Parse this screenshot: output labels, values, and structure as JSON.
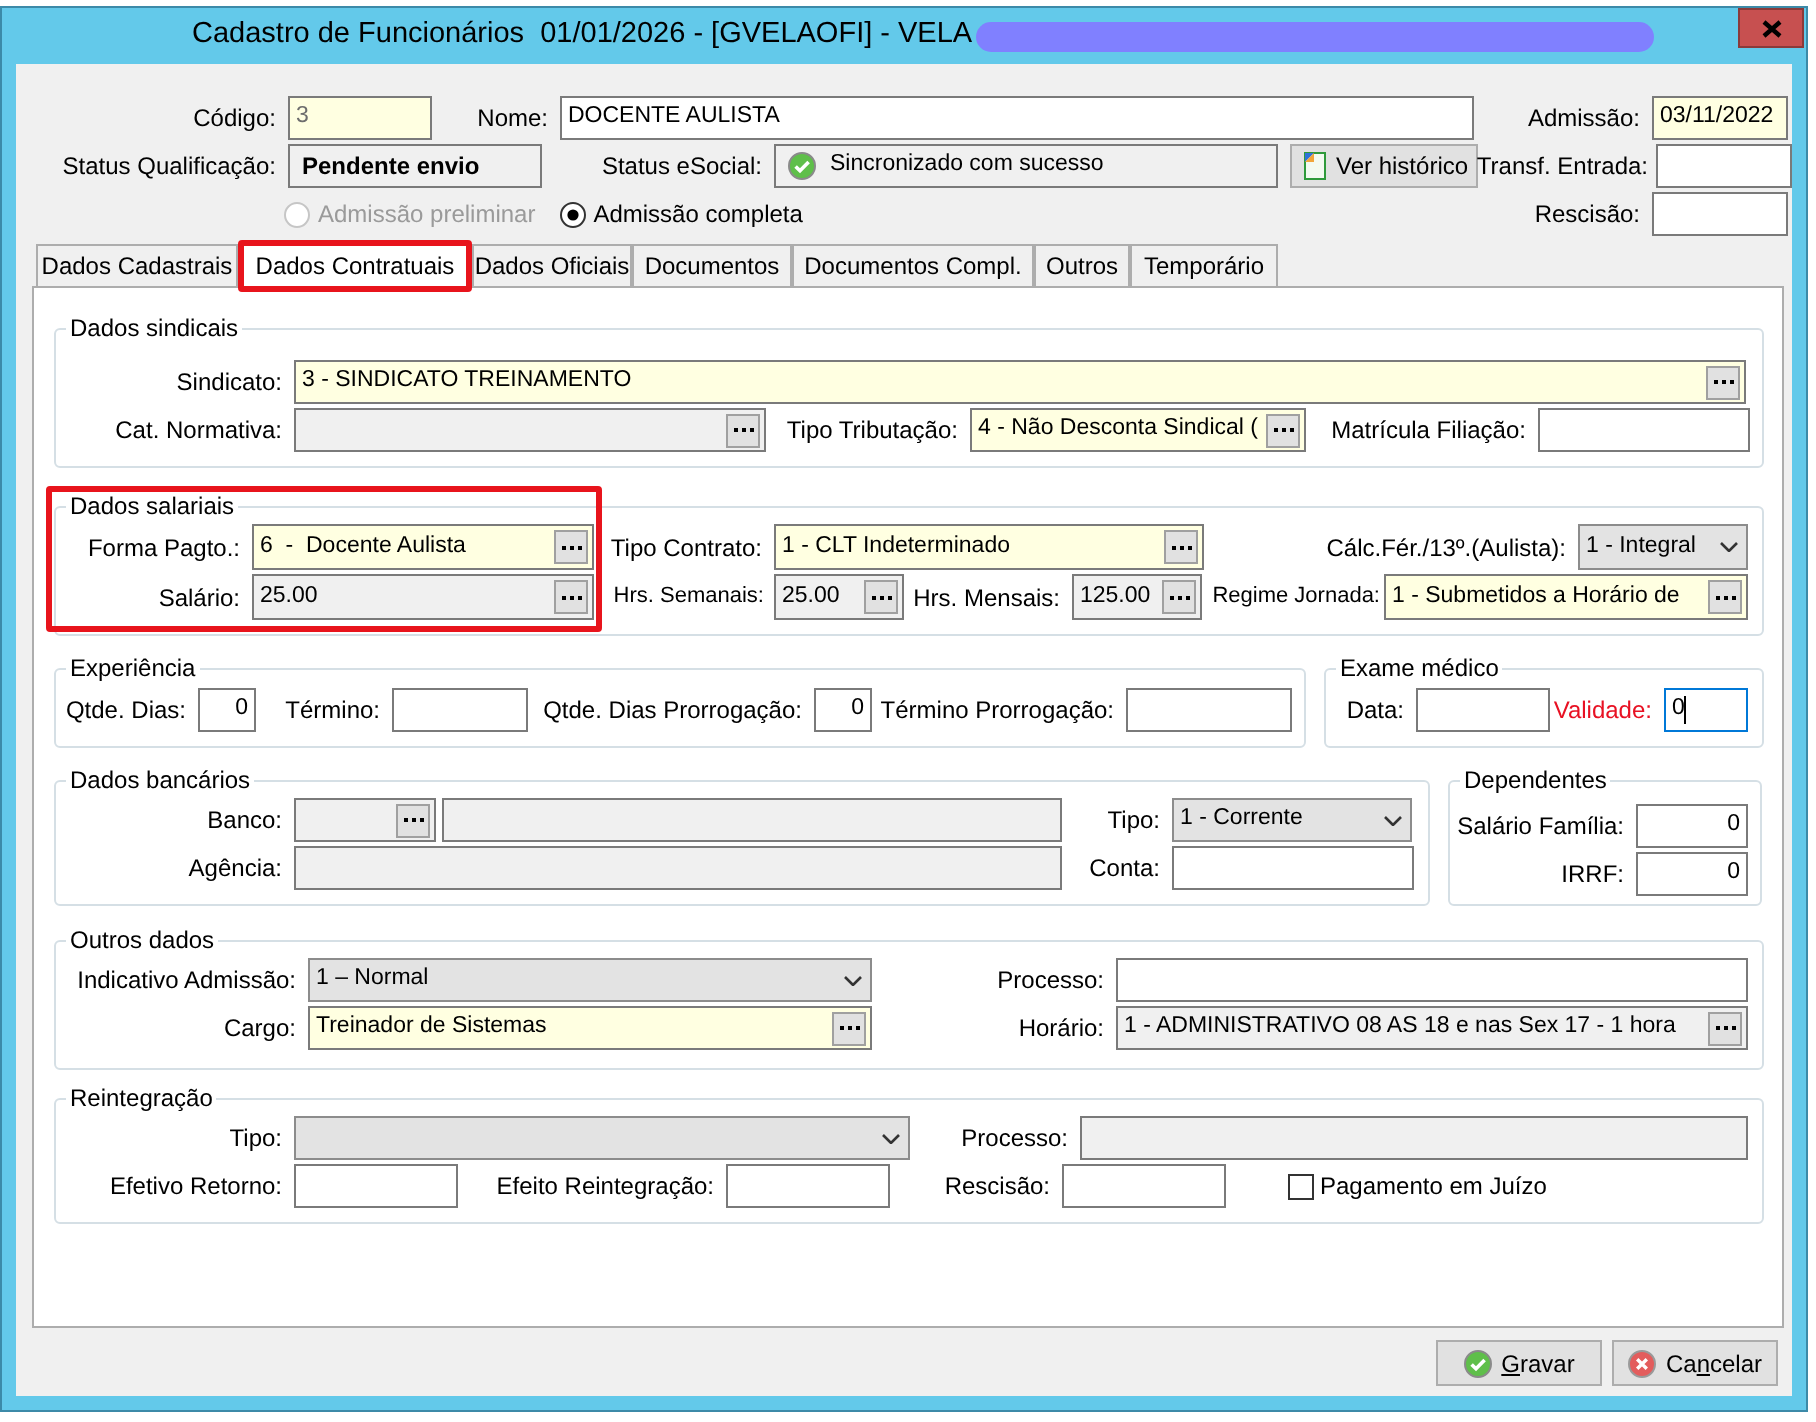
{
  "window": {
    "title": "Cadastro de Funcionários  01/01/2026 - [GVELAOFI] - VELA"
  },
  "header": [
    [
      {
        "kind": "input",
        "label": "Código:",
        "value": "3",
        "required": true,
        "readonly": true
      },
      {
        "kind": "input",
        "label": "Nome:",
        "value": "DOCENTE AULISTA",
        "required": false,
        "readonly": false
      },
      {
        "kind": "input",
        "label": "Admissão:",
        "value": "03/11/2022",
        "required": true,
        "readonly": false
      }
    ],
    [
      {
        "kind": "status",
        "label": "Status Qualificação:",
        "value": "Pendente envio",
        "synced": false
      },
      {
        "kind": "status",
        "label": "Status eSocial:",
        "value": "Sincronizado com sucesso",
        "synced": true
      },
      {
        "kind": "button",
        "label": "Ver histórico"
      },
      {
        "kind": "input",
        "label": "Transf. Entrada:",
        "required": false,
        "readonly": false
      }
    ],
    [
      {
        "kind": "radio",
        "label": "Admissão preliminar",
        "selected": false,
        "disabled": true
      },
      {
        "kind": "radio",
        "label": "Admissão completa",
        "selected": true,
        "disabled": false
      },
      {
        "kind": "input",
        "label": "Rescisão:",
        "required": false,
        "readonly": false
      }
    ]
  ],
  "tabs": [
    {
      "label": "Dados Cadastrais",
      "selected": false,
      "highlighted": false
    },
    {
      "label": "Dados Contratuais",
      "selected": true,
      "highlighted": true
    },
    {
      "label": "Dados Oficiais",
      "selected": false,
      "highlighted": false
    },
    {
      "label": "Documentos",
      "selected": false,
      "highlighted": false
    },
    {
      "label": "Documentos Compl.",
      "selected": false,
      "highlighted": false
    },
    {
      "label": "Outros",
      "selected": false,
      "highlighted": false
    },
    {
      "label": "Temporário",
      "selected": false,
      "highlighted": false
    }
  ],
  "groups": [
    {
      "title": "Dados sindicais",
      "highlighted": false,
      "rows": [
        [
          {
            "kind": "lookup",
            "label": "Sindicato:",
            "value": "3 - SINDICATO TREINAMENTO",
            "required": true,
            "readonly": false
          }
        ],
        [
          {
            "kind": "lookup",
            "label": "Cat. Normativa:",
            "required": false,
            "readonly": true
          },
          {
            "kind": "lookup",
            "label": "Tipo Tributação:",
            "value": "4 - Não Desconta Sindical (",
            "required": true,
            "readonly": false
          },
          {
            "kind": "input",
            "label": "Matrícula Filiação:",
            "required": false,
            "readonly": false
          }
        ]
      ]
    },
    {
      "title": "Dados salariais",
      "highlighted": true,
      "rows": [
        [
          {
            "kind": "lookup",
            "label": "Forma Pagto.:",
            "value": "6  -  Docente Aulista",
            "required": true,
            "readonly": false
          },
          {
            "kind": "lookup",
            "label": "Tipo Contrato:",
            "value": "1 - CLT Indeterminado",
            "required": true,
            "readonly": false
          },
          "",
          {
            "kind": "select",
            "label": "Cálc.Fér./13º.(Aulista):",
            "value": "1 - Integral"
          }
        ],
        [
          {
            "kind": "lookup",
            "label": "Salário:",
            "value": "25.00",
            "required": false,
            "readonly": true
          },
          {
            "kind": "lookup",
            "label": "Hrs. Semanais:",
            "value": "25.00",
            "required": false,
            "readonly": true
          },
          {
            "kind": "lookup",
            "label": "Hrs. Mensais:",
            "value": "125.00",
            "required": false,
            "readonly": true
          },
          {
            "kind": "lookup",
            "label": "Regime Jornada:",
            "value": "1 - Submetidos a Horário de",
            "required": true,
            "readonly": false
          }
        ]
      ]
    },
    {
      "title": "Experiência",
      "highlighted": false,
      "rows": [
        [
          {
            "kind": "input",
            "label": "Qtde. Dias:",
            "value": "0",
            "required": false,
            "readonly": false
          },
          {
            "kind": "input",
            "label": "Término:",
            "required": false,
            "readonly": false
          },
          {
            "kind": "input",
            "label": "Qtde. Dias Prorrogação:",
            "value": "0",
            "required": false,
            "readonly": false
          },
          {
            "kind": "input",
            "label": "Término Prorrogação:",
            "required": false,
            "readonly": false
          }
        ]
      ]
    },
    {
      "title": "Exame médico",
      "highlighted": false,
      "rows": [
        [
          {
            "kind": "input",
            "label": "Data:",
            "required": false,
            "readonly": false,
            "focused": false,
            "label_alert": false
          },
          {
            "kind": "input",
            "label": "Validade:",
            "value": "0",
            "required": false,
            "readonly": false,
            "focused": true,
            "label_alert": true
          }
        ]
      ]
    },
    {
      "title": "Dados bancários",
      "highlighted": false,
      "rows": [
        [
          {
            "kind": "lookup",
            "label": "Banco:",
            "required": false,
            "readonly": true
          },
          {
            "kind": "input",
            "required": false,
            "readonly": true
          },
          {
            "kind": "select",
            "label": "Tipo:",
            "value": "1 - Corrente"
          }
        ],
        [
          {
            "kind": "input",
            "label": "Agência:",
            "required": false,
            "readonly": true
          },
          {
            "kind": "input",
            "label": "Conta:",
            "required": false,
            "readonly": false
          }
        ]
      ]
    },
    {
      "title": "Dependentes",
      "highlighted": false,
      "rows": [
        [
          {
            "kind": "input",
            "label": "Salário Família:",
            "value": "0",
            "required": false,
            "readonly": false
          }
        ],
        [
          {
            "kind": "input",
            "label": "IRRF:",
            "value": "0",
            "required": false,
            "readonly": false
          }
        ]
      ]
    },
    {
      "title": "Outros dados",
      "highlighted": false,
      "rows": [
        [
          {
            "kind": "select",
            "label": "Indicativo Admissão:",
            "value": "1 – Normal"
          },
          {
            "kind": "input",
            "label": "Processo:",
            "required": false,
            "readonly": false
          }
        ],
        [
          {
            "kind": "lookup",
            "label": "Cargo:",
            "value": "Treinador de Sistemas",
            "required": true,
            "readonly": false
          },
          {
            "kind": "lookup",
            "label": "Horário:",
            "value": "1 - ADMINISTRATIVO 08 AS 18 e nas Sex 17 - 1 hora",
            "required": false,
            "readonly": true
          }
        ]
      ]
    },
    {
      "title": "Reintegração",
      "highlighted": false,
      "rows": [
        [
          {
            "kind": "select",
            "label": "Tipo:"
          },
          "",
          {
            "kind": "input",
            "label": "Processo:",
            "required": false,
            "readonly": true
          }
        ],
        [
          {
            "kind": "input",
            "label": "Efetivo Retorno:",
            "required": false,
            "readonly": false
          },
          {
            "kind": "input",
            "label": "Efeito Reintegração:",
            "required": false,
            "readonly": false
          },
          {
            "kind": "input",
            "label": "Rescisão:",
            "required": false,
            "readonly": false
          },
          {
            "kind": "checkbox",
            "label": "Pagamento em Juízo",
            "checked": false
          }
        ]
      ]
    }
  ],
  "buttons": [
    {
      "kind": "save",
      "access_key": "G",
      "label_end": "ravar"
    },
    {
      "kind": "cancel",
      "label_start": "Ca",
      "access_key": "n",
      "label_end": "celar"
    }
  ]
}
